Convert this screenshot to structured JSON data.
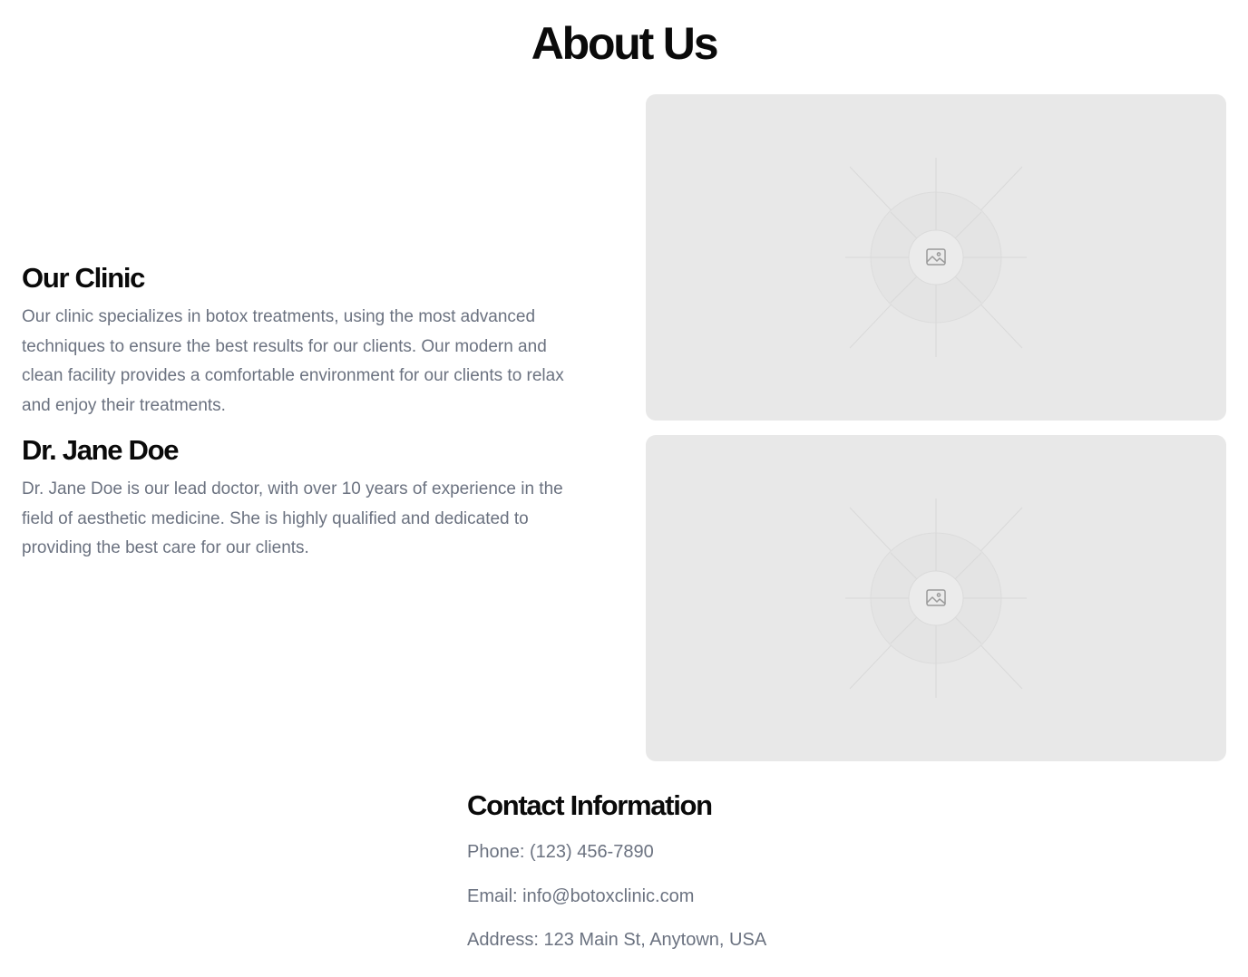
{
  "page": {
    "title": "About Us"
  },
  "clinic": {
    "heading": "Our Clinic",
    "body": "Our clinic specializes in botox treatments, using the most advanced techniques to ensure the best results for our clients. Our modern and clean facility provides a comfortable environment for our clients to relax and enjoy their treatments.",
    "image_icon": "image-icon"
  },
  "doctor": {
    "heading": "Dr. Jane Doe",
    "body": "Dr. Jane Doe is our lead doctor, with over 10 years of experience in the field of aesthetic medicine. She is highly qualified and dedicated to providing the best care for our clients.",
    "image_icon": "image-icon"
  },
  "contact": {
    "heading": "Contact Information",
    "phone": "Phone: (123) 456-7890",
    "email": "Email: info@botoxclinic.com",
    "address": "Address: 123 Main St, Anytown, USA"
  },
  "colors": {
    "heading": "#0a0a0a",
    "body_text": "#6b7280",
    "placeholder_bg": "#e8e8e8",
    "placeholder_lines": "#d6d6d6"
  }
}
